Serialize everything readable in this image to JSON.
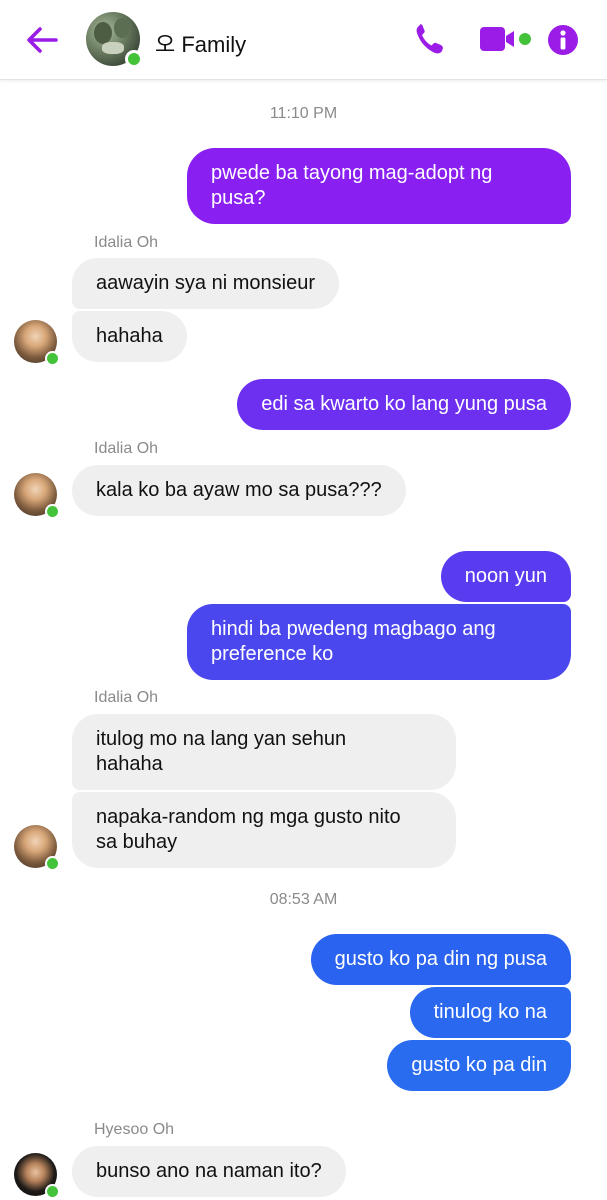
{
  "header": {
    "title": "오 Family",
    "accent_color": "#9b1ce6",
    "online_color": "#44c23a",
    "icons": {
      "back": "arrow-left-icon",
      "call": "phone-icon",
      "video": "video-camera-icon",
      "info": "info-icon"
    }
  },
  "timestamps": [
    "11:10 PM",
    "08:53 AM"
  ],
  "senders": {
    "idalia": "Idalia Oh",
    "hyesoo": "Hyesoo Oh"
  },
  "messages": [
    {
      "from": "me",
      "text": "pwede ba tayong mag-adopt ng\npusa?",
      "color": "#8a1ff2"
    },
    {
      "from": "Idalia Oh",
      "text": "aawayin sya ni monsieur"
    },
    {
      "from": "Idalia Oh",
      "text": "hahaha"
    },
    {
      "from": "me",
      "text": "edi sa kwarto ko lang yung pusa",
      "color": "#6d2ff0"
    },
    {
      "from": "Idalia Oh",
      "text": "kala ko ba ayaw mo sa pusa???"
    },
    {
      "from": "me",
      "text": "noon yun",
      "color": "#5a3cf0"
    },
    {
      "from": "me",
      "text": "hindi ba pwedeng magbago ang\npreference ko",
      "color": "#4b47ef"
    },
    {
      "from": "Idalia Oh",
      "text": "itulog mo na lang yan sehun\nhahaha"
    },
    {
      "from": "Idalia Oh",
      "text": "napaka-random ng mga gusto nito\nsa buhay"
    },
    {
      "from": "me",
      "text": "gusto ko pa din ng pusa",
      "color": "#2a63ef"
    },
    {
      "from": "me",
      "text": "tinulog ko na",
      "color": "#2a68ef"
    },
    {
      "from": "me",
      "text": "gusto ko pa din",
      "color": "#2a6cef"
    },
    {
      "from": "Hyesoo Oh",
      "text": "bunso ano na naman ito?"
    }
  ]
}
